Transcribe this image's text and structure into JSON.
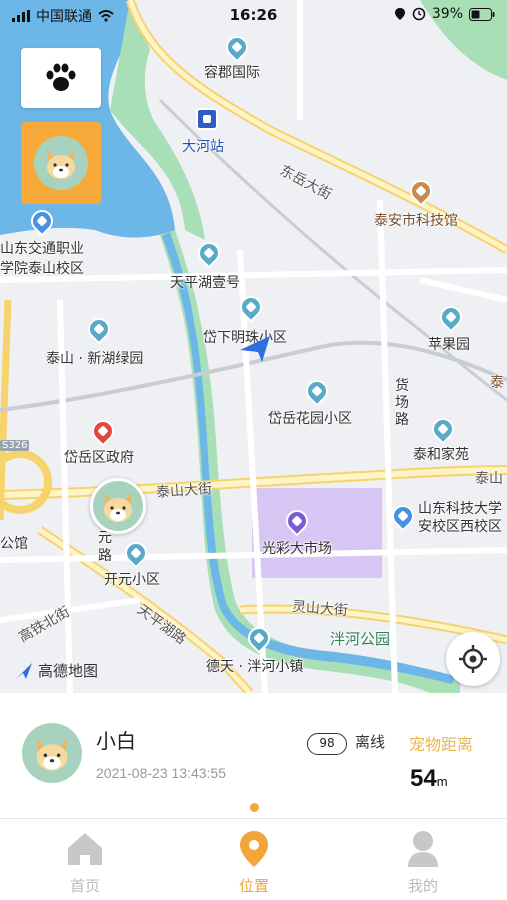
{
  "status_bar": {
    "carrier": "中国联通",
    "time": "16:26",
    "battery": "39%"
  },
  "map": {
    "labels": {
      "rongjun": "容郡国际",
      "dahe_station": "大河站",
      "dongyue": "东岳大街",
      "museum": "泰安市科技馆",
      "college_1": "山东交通职业",
      "college_2": "学院泰山校区",
      "tianping": "天平湖壹号",
      "mingzhu": "岱下明珠小区",
      "xinhu": "泰山 · 新湖绿园",
      "pingguo": "苹果园",
      "huochang": "货场路",
      "taian_partial": "泰",
      "huayuan": "岱岳花园小区",
      "taihe": "泰和家苑",
      "gov": "岱岳区政府",
      "s326": "S326",
      "taishan_st": "泰山大街",
      "taishan_r": "泰山",
      "univ_1": "山东科技大学",
      "univ_2": "安校区西校区",
      "guangcai": "光彩大市场",
      "gongguan": "公馆",
      "yuan": "元",
      "lu": "路",
      "kaiyuan": "开元小区",
      "tianpinghu_rd": "天平湖路",
      "lingshan": "灵山大街",
      "banhe_park": "泮河公园",
      "gaotie": "高铁北街",
      "detian": "德天 · 泮河小镇",
      "logo": "高德地图"
    }
  },
  "pet": {
    "name": "小白",
    "timestamp": "2021-08-23 13:43:55",
    "badge": "98",
    "status": "离线",
    "distance_label": "宠物距离",
    "distance_value": "54",
    "distance_unit": "m"
  },
  "tabs": [
    {
      "label": "首页",
      "icon": "home-icon"
    },
    {
      "label": "位置",
      "icon": "location-pin-icon"
    },
    {
      "label": "我的",
      "icon": "user-icon"
    }
  ],
  "colors": {
    "accent": "#f3a53a",
    "water": "#6db6e8",
    "park": "#a9dfb7",
    "avatar_bg": "#a7d3be"
  }
}
